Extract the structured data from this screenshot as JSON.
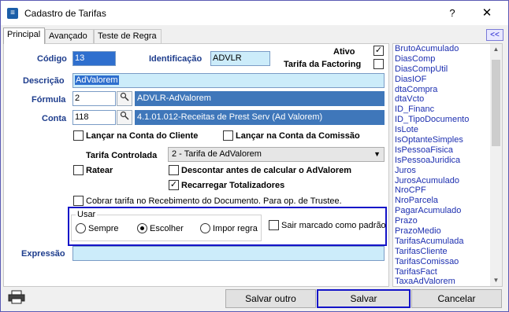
{
  "window": {
    "title": "Cadastro de Tarifas",
    "help_label": "?",
    "close_label": "✕"
  },
  "tabs": [
    {
      "label": "Principal"
    },
    {
      "label": "Avançado"
    },
    {
      "label": "Teste de Regra"
    }
  ],
  "collapse_label": "<<",
  "form": {
    "codigo": {
      "label": "Código",
      "value": "13"
    },
    "identificacao": {
      "label": "Identificação",
      "value": "ADVLR"
    },
    "ativo": {
      "label": "Ativo",
      "checked": true
    },
    "tarifa_factoring": {
      "label": "Tarifa da Factoring",
      "checked": false
    },
    "descricao": {
      "label": "Descrição",
      "value": "AdValorem"
    },
    "formula": {
      "label": "Fórmula",
      "code": "2",
      "name": "ADVLR-AdValorem"
    },
    "conta": {
      "label": "Conta",
      "code": "118",
      "name": "4.1.01.012-Receitas de Prest Serv (Ad Valorem)"
    },
    "lancar_conta_cliente": {
      "label": "Lançar na Conta do Cliente",
      "checked": false
    },
    "lancar_conta_comissao": {
      "label": "Lançar na Conta da Comissão",
      "checked": false
    },
    "tarifa_controlada": {
      "label": "Tarifa Controlada",
      "value": "2 - Tarifa de AdValorem"
    },
    "ratear": {
      "label": "Ratear",
      "checked": false
    },
    "descontar": {
      "label": "Descontar antes de calcular o AdValorem",
      "checked": false
    },
    "recarregar": {
      "label": "Recarregar Totalizadores",
      "checked": true
    },
    "cobrar_tarifa": {
      "label": "Cobrar tarifa no Recebimento do Documento. Para op. de Trustee.",
      "checked": false
    },
    "usar": {
      "legend": "Usar",
      "options": [
        "Sempre",
        "Escolher",
        "Impor regra"
      ],
      "selected": "Escolher"
    },
    "sair_marcado": {
      "label": "Sair marcado como padrão",
      "checked": false
    },
    "expressao": {
      "label": "Expressão",
      "value": ""
    }
  },
  "sidebar": {
    "items": [
      "BrutoAcumulado",
      "DiasComp",
      "DiasCompUtil",
      "DiasIOF",
      "dtaCompra",
      "dtaVcto",
      "ID_Financ",
      "ID_TipoDocumento",
      "IsLote",
      "IsOptanteSimples",
      "IsPessoaFisica",
      "IsPessoaJuridica",
      "Juros",
      "JurosAcumulado",
      "NroCPF",
      "NroParcela",
      "PagarAcumulado",
      "Prazo",
      "PrazoMedio",
      "TarifasAcumulada",
      "TarifasCliente",
      "TarifasComissao",
      "TarifasFact",
      "TaxaAdValorem"
    ]
  },
  "buttons": {
    "salvar_outro": "Salvar outro",
    "salvar": "Salvar",
    "cancelar": "Cancelar"
  }
}
